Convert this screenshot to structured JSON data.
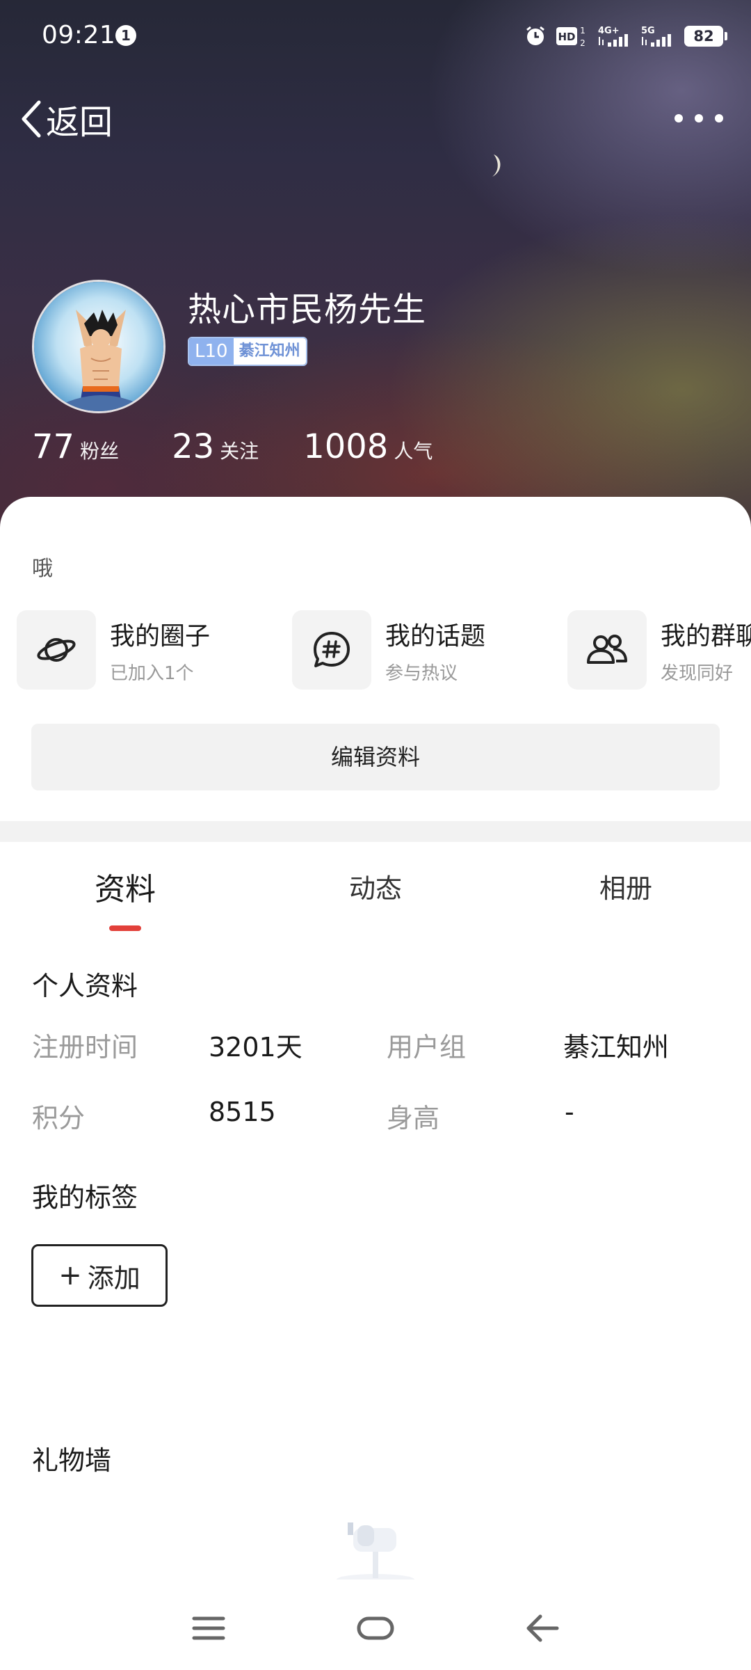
{
  "status_bar": {
    "time": "09:21",
    "notification_count": "1",
    "battery": "82",
    "icons": [
      "alarm-icon",
      "hd-icon",
      "4g-signal-icon",
      "5g-signal-icon",
      "battery-icon"
    ]
  },
  "nav": {
    "back_label": "返回",
    "more_icon": "more-icon"
  },
  "profile": {
    "username": "热心市民杨先生",
    "level": "L10",
    "level_title": "綦江知州",
    "stats": [
      {
        "num": "77",
        "label": "粉丝"
      },
      {
        "num": "23",
        "label": "关注"
      },
      {
        "num": "1008",
        "label": "人气"
      }
    ],
    "bio": "哦"
  },
  "features": [
    {
      "title": "我的圈子",
      "subtitle": "已加入1个",
      "icon": "planet-icon"
    },
    {
      "title": "我的话题",
      "subtitle": "参与热议",
      "icon": "topic-hashtag-icon"
    },
    {
      "title": "我的群聊",
      "subtitle": "发现同好",
      "icon": "group-chat-icon"
    }
  ],
  "edit_button": "编辑资料",
  "tabs": [
    {
      "label": "资料",
      "active": true
    },
    {
      "label": "动态",
      "active": false
    },
    {
      "label": "相册",
      "active": false
    }
  ],
  "personal_info": {
    "title": "个人资料",
    "rows": [
      {
        "label1": "注册时间",
        "value1": "3201天",
        "label2": "用户组",
        "value2": "綦江知州"
      },
      {
        "label1": "积分",
        "value1": "8515",
        "label2": "身高",
        "value2": "-"
      }
    ]
  },
  "my_tags": {
    "title": "我的标签",
    "add_label": "添加"
  },
  "gift_wall": {
    "title": "礼物墙"
  },
  "colors": {
    "accent_red": "#e2403a",
    "level_blue": "#8fb2ee"
  }
}
